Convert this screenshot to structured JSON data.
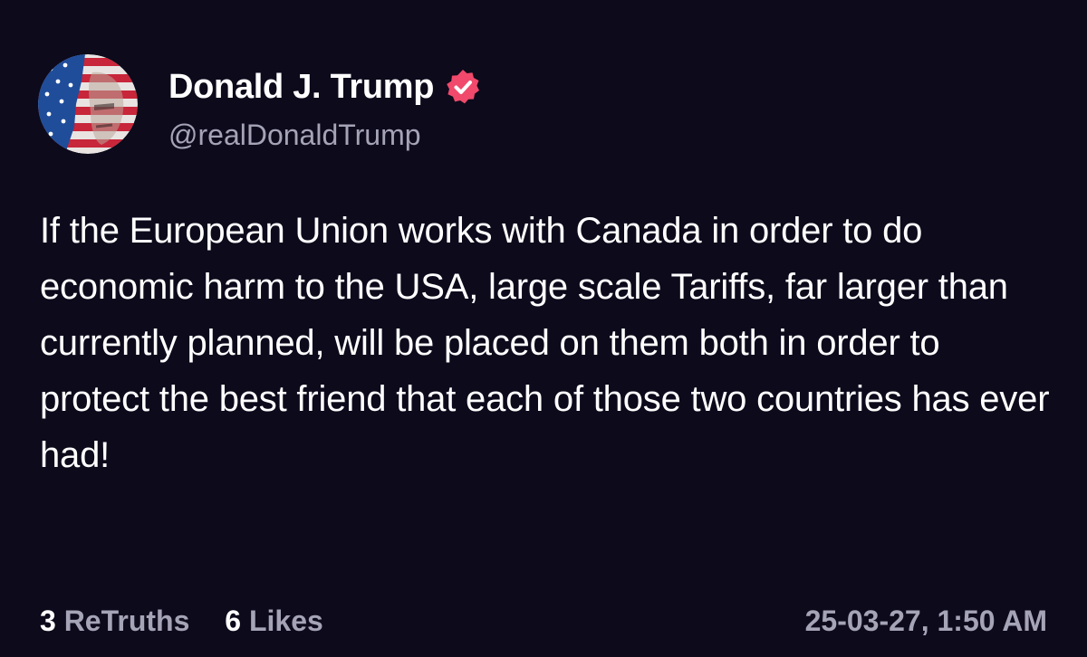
{
  "post": {
    "author": {
      "display_name": "Donald J. Trump",
      "handle": "@realDonaldTrump",
      "verified_badge_icon": "verified-check-icon",
      "avatar_icon": "flag-portrait-avatar"
    },
    "body": "If the European Union works with Canada in order to do economic harm to the USA, large scale Tariffs, far larger than currently planned, will be placed on them both in order to protect the best friend that each of those two countries has ever had!",
    "stats": {
      "retruths_count": "3",
      "retruths_label": "ReTruths",
      "likes_count": "6",
      "likes_label": "Likes"
    },
    "timestamp": "25-03-27, 1:50 AM"
  },
  "colors": {
    "background": "#0c0a1b",
    "text_primary": "#ffffff",
    "text_secondary": "#a5a3b6",
    "verified_badge": "#f0496b"
  }
}
